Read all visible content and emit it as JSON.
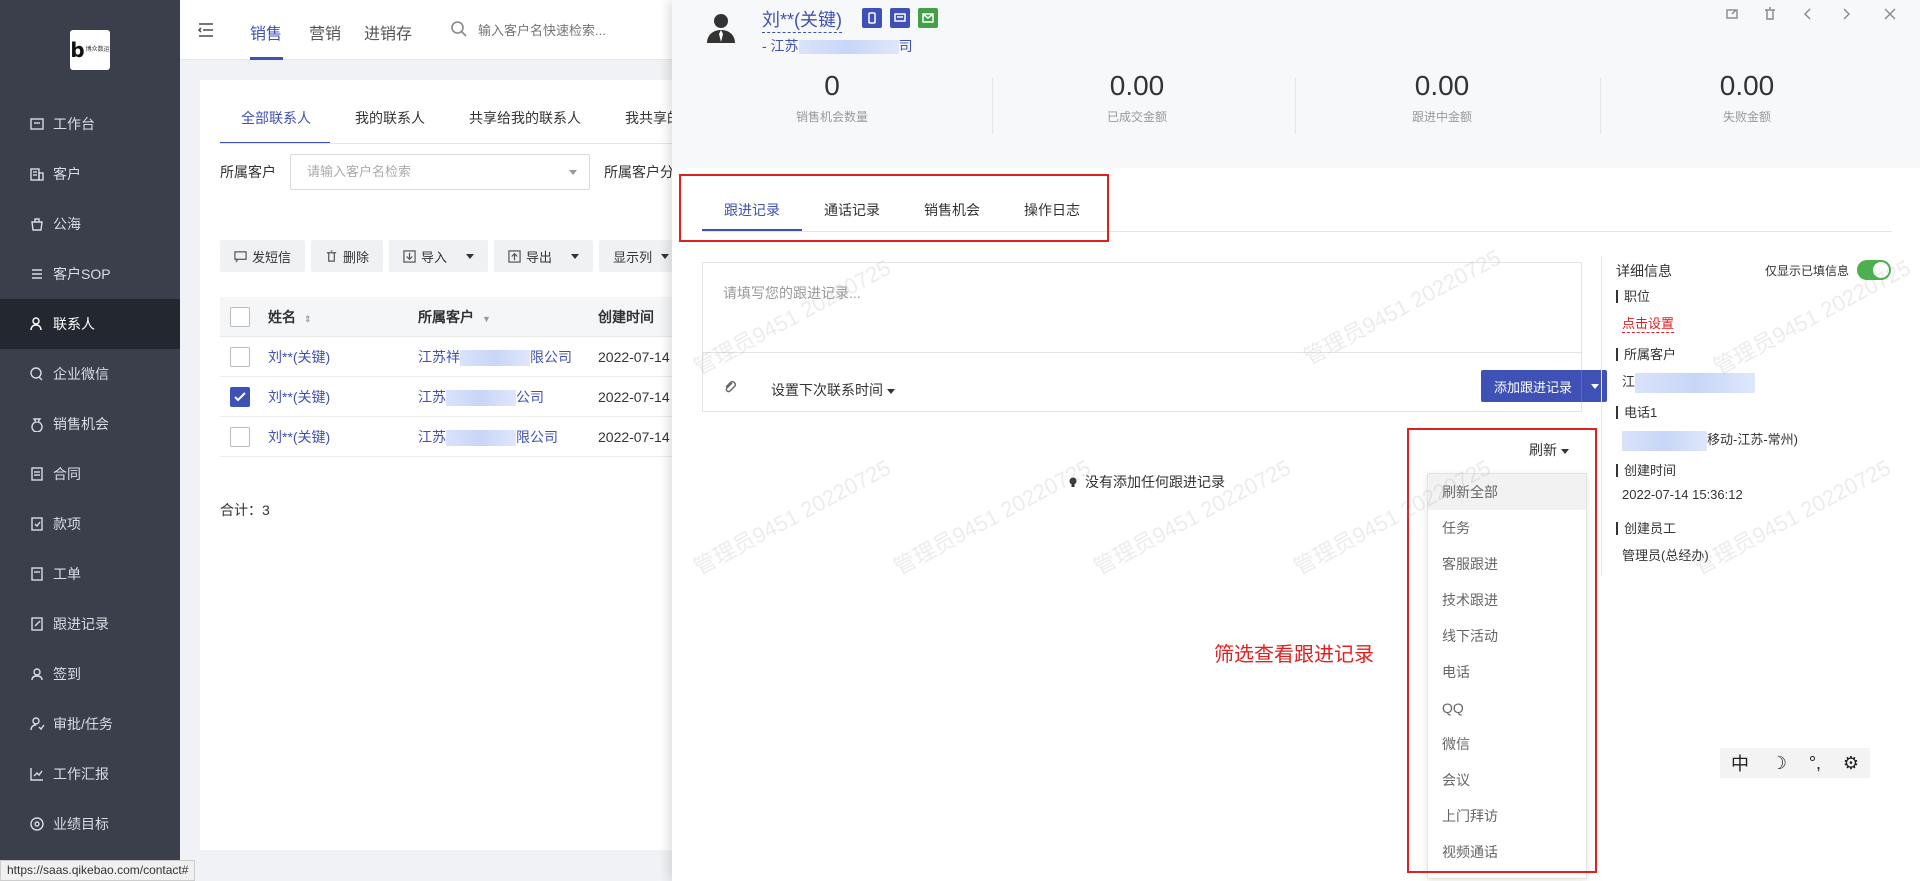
{
  "sidebar": {
    "logo_text": "博众数运",
    "items": [
      {
        "label": "工作台",
        "icon": "dashboard-icon"
      },
      {
        "label": "客户",
        "icon": "building-icon"
      },
      {
        "label": "公海",
        "icon": "pool-icon"
      },
      {
        "label": "客户SOP",
        "icon": "sop-icon"
      },
      {
        "label": "联系人",
        "icon": "contact-icon",
        "active": true
      },
      {
        "label": "企业微信",
        "icon": "wechat-icon"
      },
      {
        "label": "销售机会",
        "icon": "money-bag-icon"
      },
      {
        "label": "合同",
        "icon": "contract-icon"
      },
      {
        "label": "款项",
        "icon": "payment-icon"
      },
      {
        "label": "工单",
        "icon": "ticket-icon"
      },
      {
        "label": "跟进记录",
        "icon": "followup-icon"
      },
      {
        "label": "签到",
        "icon": "checkin-icon"
      },
      {
        "label": "审批/任务",
        "icon": "approval-icon"
      },
      {
        "label": "工作汇报",
        "icon": "report-icon"
      },
      {
        "label": "业绩目标",
        "icon": "target-icon"
      }
    ]
  },
  "topbar": {
    "tabs": [
      "销售",
      "营销",
      "进销存"
    ],
    "search_placeholder": "输入客户名快速检索..."
  },
  "list": {
    "subtabs": [
      "全部联系人",
      "我的联系人",
      "共享给我的联系人",
      "我共享的"
    ],
    "filter_label": "所属客户",
    "filter_placeholder": "请输入客户名检索",
    "filter_label2": "所属客户分",
    "toolbar": [
      "发短信",
      "删除",
      "导入",
      "导出",
      "显示列"
    ],
    "columns": [
      "姓名",
      "所属客户",
      "创建时间"
    ],
    "rows": [
      {
        "name": "刘**(关键)",
        "customer_prefix": "江苏祥",
        "customer_suffix": "限公司",
        "time": "2022-07-14",
        "checked": false
      },
      {
        "name": "刘**(关键)",
        "customer_prefix": "江苏",
        "customer_suffix": "公司",
        "time": "2022-07-14",
        "checked": true
      },
      {
        "name": "刘**(关键)",
        "customer_prefix": "江苏",
        "customer_suffix": "限公司",
        "time": "2022-07-14",
        "checked": false
      }
    ],
    "total": "合计：3"
  },
  "drawer": {
    "contact_name": "刘**(关键)",
    "company_prefix": "- 江苏",
    "company_suffix": "司",
    "stats": [
      {
        "value": "0",
        "label": "销售机会数量"
      },
      {
        "value": "0.00",
        "label": "已成交金额"
      },
      {
        "value": "0.00",
        "label": "跟进中金额"
      },
      {
        "value": "0.00",
        "label": "失败金额"
      }
    ],
    "tabs": [
      "跟进记录",
      "通话记录",
      "销售机会",
      "操作日志"
    ],
    "editor_placeholder": "请填写您的跟进记录...",
    "next_time_label": "设置下次联系时间",
    "add_button": "添加跟进记录",
    "refresh_label": "刷新",
    "empty_note": "没有添加任何跟进记录",
    "annotation": "筛选查看跟进记录",
    "dropdown_items": [
      "刷新全部",
      "任务",
      "客服跟进",
      "技术跟进",
      "线下活动",
      "电话",
      "QQ",
      "微信",
      "会议",
      "上门拜访",
      "视频通话"
    ],
    "details": {
      "title": "详细信息",
      "toggle_label": "仅显示已填信息",
      "toggle_on": true,
      "position_label": "职位",
      "position_value": "点击设置",
      "customer_label": "所属客户",
      "customer_value": "江",
      "phone_label": "电话1",
      "phone_suffix": "移动-江苏-常州)",
      "created_label": "创建时间",
      "created_value": "2022-07-14 15:36:12",
      "creator_label": "创建员工",
      "creator_value": "管理员(总经办)"
    },
    "watermark": "管理员9451 20220725"
  },
  "ime": {
    "chars": [
      "中",
      "☽",
      "°,",
      "⚙"
    ]
  },
  "status_url": "https://saas.qikebao.com/contact#",
  "colors": {
    "accent": "#3f51b5",
    "annotation": "#e02020",
    "sidebar": "#3a3f4b"
  }
}
